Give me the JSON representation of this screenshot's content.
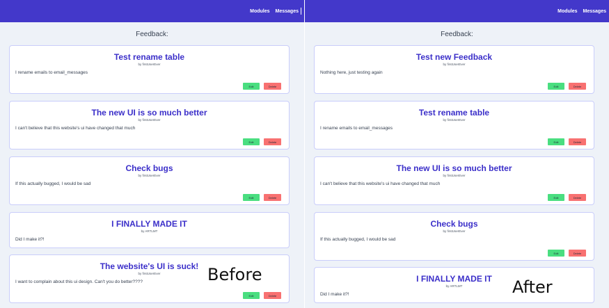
{
  "nav": {
    "modules": "Modules",
    "messages": "Messages"
  },
  "heading": "Feedback:",
  "buttons": {
    "edit": "Edit",
    "delete": "Delete"
  },
  "before": {
    "caption": "Before",
    "cards": [
      {
        "title": "Test rename table",
        "author": "by firstUserEver",
        "body": "I rename emails to email_messages"
      },
      {
        "title": "The new UI is so much better",
        "author": "by firstUserEver",
        "body": "I can't believe that this website's ui have changed that much"
      },
      {
        "title": "Check bugs",
        "author": "by firstUserEver",
        "body": "If this actually bugged, I would be sad"
      },
      {
        "title": "I FINALLY MADE IT",
        "author": "by ARTLMT",
        "body": "Did I make it?!"
      },
      {
        "title": "The website's UI is suck!",
        "author": "by firstUserEver",
        "body": "I want to complain about this ui design. Can't you do better????"
      }
    ]
  },
  "after": {
    "caption": "After",
    "cards": [
      {
        "title": "Test new Feedback",
        "author": "by firstUserEver",
        "body": "Nothing here, just testing again"
      },
      {
        "title": "Test rename table",
        "author": "by firstUserEver",
        "body": "I rename emails to email_messages"
      },
      {
        "title": "The new UI is so much better",
        "author": "by firstUserEver",
        "body": "I can't believe that this website's ui have changed that much"
      },
      {
        "title": "Check bugs",
        "author": "by firstUserEver",
        "body": "If this actually bugged, I would be sad"
      },
      {
        "title": "I FINALLY MADE IT",
        "author": "by ARTLMT",
        "body": "Did I make it?!"
      }
    ]
  }
}
